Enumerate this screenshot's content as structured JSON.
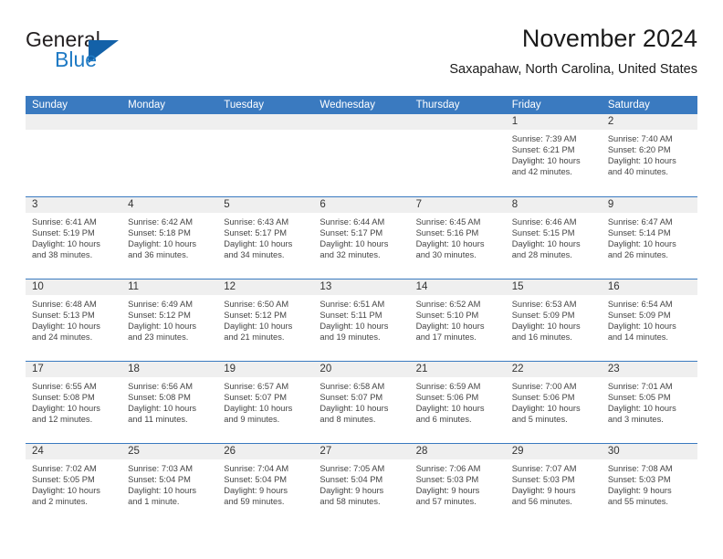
{
  "brand": {
    "name_top": "General",
    "name_bottom": "Blue",
    "triangle_color": "#1361a8",
    "blue_text_color": "#1f7ac4"
  },
  "header": {
    "title": "November 2024",
    "subtitle": "Saxapahaw, North Carolina, United States"
  },
  "theme": {
    "header_bg": "#3a7ac0",
    "header_text": "#ffffff",
    "date_band_bg": "#efefef",
    "row_separator": "#3a7ac0",
    "page_bg": "#ffffff",
    "body_text": "#444444"
  },
  "weekday_headers": [
    "Sunday",
    "Monday",
    "Tuesday",
    "Wednesday",
    "Thursday",
    "Friday",
    "Saturday"
  ],
  "labels": {
    "sunrise": "Sunrise:",
    "sunset": "Sunset:",
    "daylight": "Daylight:"
  },
  "weeks": [
    [
      {
        "empty": true
      },
      {
        "empty": true
      },
      {
        "empty": true
      },
      {
        "empty": true
      },
      {
        "empty": true
      },
      {
        "day": "1",
        "sunrise": "Sunrise: 7:39 AM",
        "sunset": "Sunset: 6:21 PM",
        "daylight_line1": "Daylight: 10 hours",
        "daylight_line2": "and 42 minutes."
      },
      {
        "day": "2",
        "sunrise": "Sunrise: 7:40 AM",
        "sunset": "Sunset: 6:20 PM",
        "daylight_line1": "Daylight: 10 hours",
        "daylight_line2": "and 40 minutes."
      }
    ],
    [
      {
        "day": "3",
        "sunrise": "Sunrise: 6:41 AM",
        "sunset": "Sunset: 5:19 PM",
        "daylight_line1": "Daylight: 10 hours",
        "daylight_line2": "and 38 minutes."
      },
      {
        "day": "4",
        "sunrise": "Sunrise: 6:42 AM",
        "sunset": "Sunset: 5:18 PM",
        "daylight_line1": "Daylight: 10 hours",
        "daylight_line2": "and 36 minutes."
      },
      {
        "day": "5",
        "sunrise": "Sunrise: 6:43 AM",
        "sunset": "Sunset: 5:17 PM",
        "daylight_line1": "Daylight: 10 hours",
        "daylight_line2": "and 34 minutes."
      },
      {
        "day": "6",
        "sunrise": "Sunrise: 6:44 AM",
        "sunset": "Sunset: 5:17 PM",
        "daylight_line1": "Daylight: 10 hours",
        "daylight_line2": "and 32 minutes."
      },
      {
        "day": "7",
        "sunrise": "Sunrise: 6:45 AM",
        "sunset": "Sunset: 5:16 PM",
        "daylight_line1": "Daylight: 10 hours",
        "daylight_line2": "and 30 minutes."
      },
      {
        "day": "8",
        "sunrise": "Sunrise: 6:46 AM",
        "sunset": "Sunset: 5:15 PM",
        "daylight_line1": "Daylight: 10 hours",
        "daylight_line2": "and 28 minutes."
      },
      {
        "day": "9",
        "sunrise": "Sunrise: 6:47 AM",
        "sunset": "Sunset: 5:14 PM",
        "daylight_line1": "Daylight: 10 hours",
        "daylight_line2": "and 26 minutes."
      }
    ],
    [
      {
        "day": "10",
        "sunrise": "Sunrise: 6:48 AM",
        "sunset": "Sunset: 5:13 PM",
        "daylight_line1": "Daylight: 10 hours",
        "daylight_line2": "and 24 minutes."
      },
      {
        "day": "11",
        "sunrise": "Sunrise: 6:49 AM",
        "sunset": "Sunset: 5:12 PM",
        "daylight_line1": "Daylight: 10 hours",
        "daylight_line2": "and 23 minutes."
      },
      {
        "day": "12",
        "sunrise": "Sunrise: 6:50 AM",
        "sunset": "Sunset: 5:12 PM",
        "daylight_line1": "Daylight: 10 hours",
        "daylight_line2": "and 21 minutes."
      },
      {
        "day": "13",
        "sunrise": "Sunrise: 6:51 AM",
        "sunset": "Sunset: 5:11 PM",
        "daylight_line1": "Daylight: 10 hours",
        "daylight_line2": "and 19 minutes."
      },
      {
        "day": "14",
        "sunrise": "Sunrise: 6:52 AM",
        "sunset": "Sunset: 5:10 PM",
        "daylight_line1": "Daylight: 10 hours",
        "daylight_line2": "and 17 minutes."
      },
      {
        "day": "15",
        "sunrise": "Sunrise: 6:53 AM",
        "sunset": "Sunset: 5:09 PM",
        "daylight_line1": "Daylight: 10 hours",
        "daylight_line2": "and 16 minutes."
      },
      {
        "day": "16",
        "sunrise": "Sunrise: 6:54 AM",
        "sunset": "Sunset: 5:09 PM",
        "daylight_line1": "Daylight: 10 hours",
        "daylight_line2": "and 14 minutes."
      }
    ],
    [
      {
        "day": "17",
        "sunrise": "Sunrise: 6:55 AM",
        "sunset": "Sunset: 5:08 PM",
        "daylight_line1": "Daylight: 10 hours",
        "daylight_line2": "and 12 minutes."
      },
      {
        "day": "18",
        "sunrise": "Sunrise: 6:56 AM",
        "sunset": "Sunset: 5:08 PM",
        "daylight_line1": "Daylight: 10 hours",
        "daylight_line2": "and 11 minutes."
      },
      {
        "day": "19",
        "sunrise": "Sunrise: 6:57 AM",
        "sunset": "Sunset: 5:07 PM",
        "daylight_line1": "Daylight: 10 hours",
        "daylight_line2": "and 9 minutes."
      },
      {
        "day": "20",
        "sunrise": "Sunrise: 6:58 AM",
        "sunset": "Sunset: 5:07 PM",
        "daylight_line1": "Daylight: 10 hours",
        "daylight_line2": "and 8 minutes."
      },
      {
        "day": "21",
        "sunrise": "Sunrise: 6:59 AM",
        "sunset": "Sunset: 5:06 PM",
        "daylight_line1": "Daylight: 10 hours",
        "daylight_line2": "and 6 minutes."
      },
      {
        "day": "22",
        "sunrise": "Sunrise: 7:00 AM",
        "sunset": "Sunset: 5:06 PM",
        "daylight_line1": "Daylight: 10 hours",
        "daylight_line2": "and 5 minutes."
      },
      {
        "day": "23",
        "sunrise": "Sunrise: 7:01 AM",
        "sunset": "Sunset: 5:05 PM",
        "daylight_line1": "Daylight: 10 hours",
        "daylight_line2": "and 3 minutes."
      }
    ],
    [
      {
        "day": "24",
        "sunrise": "Sunrise: 7:02 AM",
        "sunset": "Sunset: 5:05 PM",
        "daylight_line1": "Daylight: 10 hours",
        "daylight_line2": "and 2 minutes."
      },
      {
        "day": "25",
        "sunrise": "Sunrise: 7:03 AM",
        "sunset": "Sunset: 5:04 PM",
        "daylight_line1": "Daylight: 10 hours",
        "daylight_line2": "and 1 minute."
      },
      {
        "day": "26",
        "sunrise": "Sunrise: 7:04 AM",
        "sunset": "Sunset: 5:04 PM",
        "daylight_line1": "Daylight: 9 hours",
        "daylight_line2": "and 59 minutes."
      },
      {
        "day": "27",
        "sunrise": "Sunrise: 7:05 AM",
        "sunset": "Sunset: 5:04 PM",
        "daylight_line1": "Daylight: 9 hours",
        "daylight_line2": "and 58 minutes."
      },
      {
        "day": "28",
        "sunrise": "Sunrise: 7:06 AM",
        "sunset": "Sunset: 5:03 PM",
        "daylight_line1": "Daylight: 9 hours",
        "daylight_line2": "and 57 minutes."
      },
      {
        "day": "29",
        "sunrise": "Sunrise: 7:07 AM",
        "sunset": "Sunset: 5:03 PM",
        "daylight_line1": "Daylight: 9 hours",
        "daylight_line2": "and 56 minutes."
      },
      {
        "day": "30",
        "sunrise": "Sunrise: 7:08 AM",
        "sunset": "Sunset: 5:03 PM",
        "daylight_line1": "Daylight: 9 hours",
        "daylight_line2": "and 55 minutes."
      }
    ]
  ]
}
